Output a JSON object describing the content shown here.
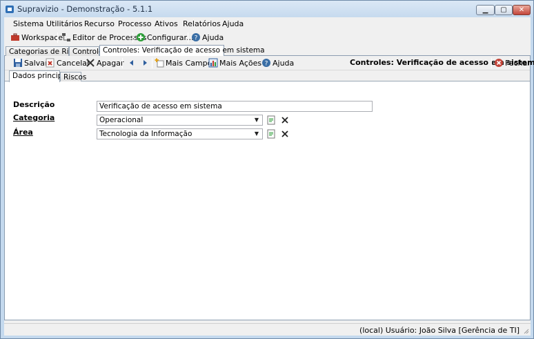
{
  "window": {
    "title": "Supravizio - Demonstração - 5.1.1"
  },
  "menu": [
    "Sistema",
    "Utilitários",
    "Recurso",
    "Processo",
    "Ativos",
    "Relatórios",
    "Ajuda"
  ],
  "toolbar": {
    "workspace": "Workspace",
    "editor": "Editor de Processos",
    "configurar": "Configurar...",
    "ajuda": "Ajuda"
  },
  "doc_tabs": [
    "Categorias de Riscos",
    "Controles",
    "Controles: Verificação de acesso em sistema"
  ],
  "actions": {
    "salvar": "Salvar",
    "cancelar": "Cancelar",
    "apagar": "Apagar",
    "mais_campos": "Mais Campos",
    "mais_acoes": "Mais Ações",
    "ajuda": "Ajuda",
    "context_title": "Controles: Verificação de acesso em sistema",
    "fechar": "Fechar"
  },
  "sub_tabs": [
    "Dados principais",
    "Riscos"
  ],
  "form": {
    "descricao_label": "Descrição",
    "descricao_value": "Verificação de acesso em sistema",
    "categoria_label": "Categoria",
    "categoria_value": "Operacional",
    "area_label": "Área",
    "area_value": "Tecnologia da Informação"
  },
  "status": {
    "text": "(local)  Usuário: João Silva [Gerência de TI]"
  },
  "colors": {
    "accent": "#3a6ea5",
    "close_red": "#c3453a"
  }
}
